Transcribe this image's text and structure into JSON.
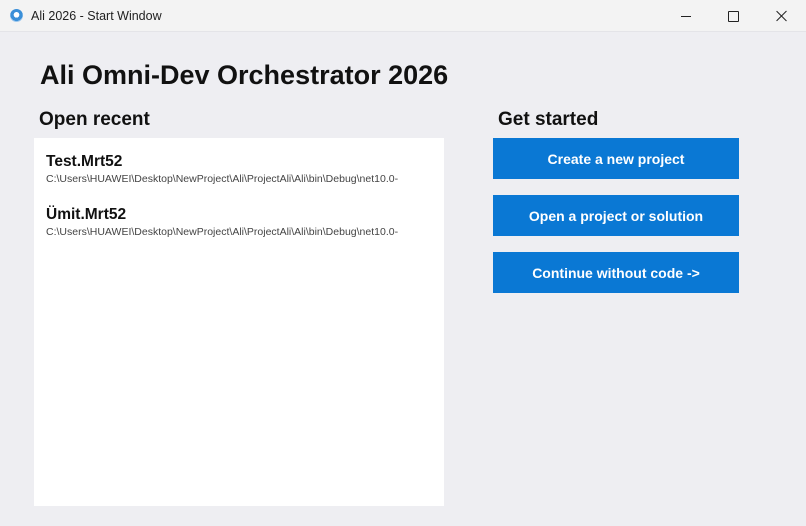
{
  "window": {
    "title": "Ali 2026 - Start Window",
    "icon": "app-logo-icon",
    "controls": [
      "minimize-icon",
      "maximize-icon",
      "close-icon"
    ]
  },
  "main": {
    "title": "Ali Omni-Dev Orchestrator 2026"
  },
  "open_recent": {
    "heading": "Open recent",
    "items": [
      {
        "name": "Test.Mrt52",
        "path": "C:\\Users\\HUAWEI\\Desktop\\NewProject\\Ali\\ProjectAli\\Ali\\bin\\Debug\\net10.0-"
      },
      {
        "name": "Ümit.Mrt52",
        "path": "C:\\Users\\HUAWEI\\Desktop\\NewProject\\Ali\\ProjectAli\\Ali\\bin\\Debug\\net10.0-"
      }
    ]
  },
  "get_started": {
    "heading": "Get started",
    "buttons": {
      "create": "Create a new project",
      "open": "Open a project or solution",
      "continue": "Continue without code ->"
    }
  },
  "colors": {
    "accent": "#0a78d4",
    "background": "#eeeef2",
    "panel": "#ffffff"
  }
}
